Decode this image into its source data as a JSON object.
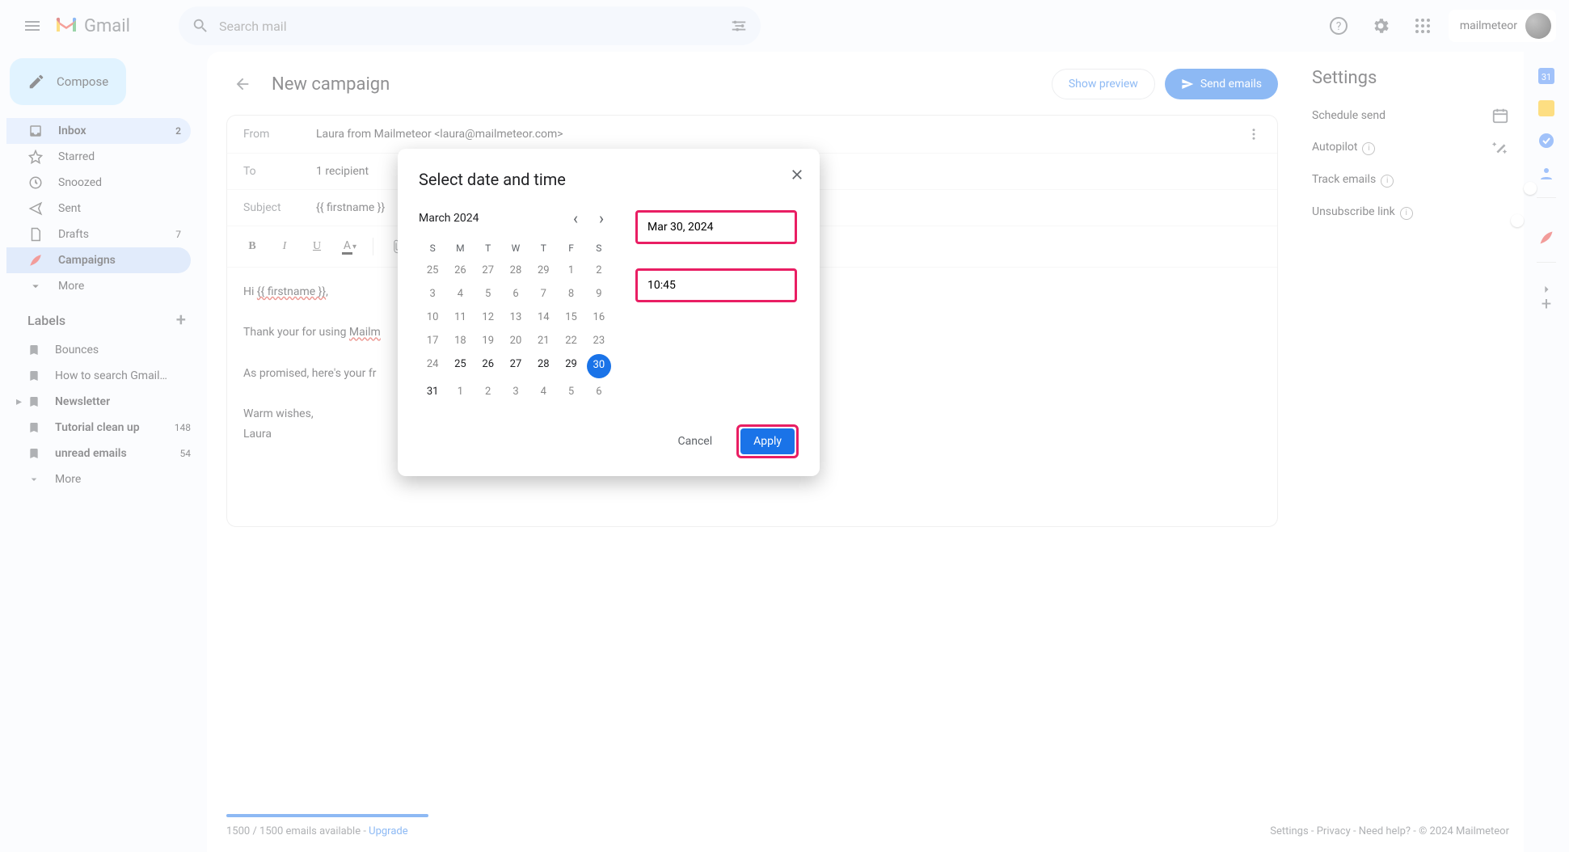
{
  "header": {
    "app_name": "Gmail",
    "search_placeholder": "Search mail",
    "account_name": "mailmeteor"
  },
  "sidebar": {
    "compose": "Compose",
    "items": [
      {
        "label": "Inbox",
        "count": "2"
      },
      {
        "label": "Starred",
        "count": ""
      },
      {
        "label": "Snoozed",
        "count": ""
      },
      {
        "label": "Sent",
        "count": ""
      },
      {
        "label": "Drafts",
        "count": "7"
      },
      {
        "label": "Campaigns",
        "count": ""
      },
      {
        "label": "More",
        "count": ""
      }
    ],
    "labels_header": "Labels",
    "labels": [
      {
        "label": "Bounces",
        "count": "",
        "bold": false
      },
      {
        "label": "How to search Gmail by ...",
        "count": "",
        "bold": false
      },
      {
        "label": "Newsletter",
        "count": "",
        "bold": true,
        "chev": true
      },
      {
        "label": "Tutorial clean up",
        "count": "148",
        "bold": true
      },
      {
        "label": "unread emails",
        "count": "54",
        "bold": true
      },
      {
        "label": "More",
        "count": "",
        "bold": false
      }
    ]
  },
  "campaign": {
    "back_title": "New campaign",
    "show_preview": "Show preview",
    "send_emails": "Send emails",
    "from_label": "From",
    "from_value": "Laura from Mailmeteor <laura@mailmeteor.com>",
    "to_label": "To",
    "to_value": "1 recipient",
    "subject_label": "Subject",
    "subject_value": "{{ firstname }}",
    "body_greeting_pre": "Hi ",
    "body_greeting_token": "{{ firstname }}",
    "body_greeting_post": ",",
    "body_line2_pre": "Thank your for using ",
    "body_line2_token": "Mailm",
    "body_line3": "As promised, here's your fr",
    "body_sign1": "Warm wishes,",
    "body_sign2": "Laura",
    "quota_text": "1500 / 1500 emails available - ",
    "quota_upgrade": "Upgrade"
  },
  "settings": {
    "title": "Settings",
    "items": [
      {
        "label": "Schedule send",
        "ctrl": "calendar"
      },
      {
        "label": "Autopilot",
        "ctrl": "wand",
        "info": true
      },
      {
        "label": "Track emails",
        "ctrl": "toggle_on",
        "info": true
      },
      {
        "label": "Unsubscribe link",
        "ctrl": "toggle_off",
        "info": true
      }
    ]
  },
  "footer": {
    "settings": "Settings",
    "privacy": "Privacy",
    "help": "Need help?",
    "copyright": "© 2024 Mailmeteor"
  },
  "modal": {
    "title": "Select date and time",
    "month": "March 2024",
    "dow": [
      "S",
      "M",
      "T",
      "W",
      "T",
      "F",
      "S"
    ],
    "days": [
      {
        "n": "25",
        "in": false
      },
      {
        "n": "26",
        "in": false
      },
      {
        "n": "27",
        "in": false
      },
      {
        "n": "28",
        "in": false
      },
      {
        "n": "29",
        "in": false
      },
      {
        "n": "1",
        "in": false
      },
      {
        "n": "2",
        "in": false
      },
      {
        "n": "3",
        "in": false
      },
      {
        "n": "4",
        "in": false
      },
      {
        "n": "5",
        "in": false
      },
      {
        "n": "6",
        "in": false
      },
      {
        "n": "7",
        "in": false
      },
      {
        "n": "8",
        "in": false
      },
      {
        "n": "9",
        "in": false
      },
      {
        "n": "10",
        "in": false
      },
      {
        "n": "11",
        "in": false
      },
      {
        "n": "12",
        "in": false
      },
      {
        "n": "13",
        "in": false
      },
      {
        "n": "14",
        "in": false
      },
      {
        "n": "15",
        "in": false
      },
      {
        "n": "16",
        "in": false
      },
      {
        "n": "17",
        "in": false
      },
      {
        "n": "18",
        "in": false
      },
      {
        "n": "19",
        "in": false
      },
      {
        "n": "20",
        "in": false
      },
      {
        "n": "21",
        "in": false
      },
      {
        "n": "22",
        "in": false
      },
      {
        "n": "23",
        "in": false
      },
      {
        "n": "24",
        "in": false
      },
      {
        "n": "25",
        "in": true
      },
      {
        "n": "26",
        "in": true
      },
      {
        "n": "27",
        "in": true
      },
      {
        "n": "28",
        "in": true
      },
      {
        "n": "29",
        "in": true
      },
      {
        "n": "30",
        "in": true,
        "sel": true
      },
      {
        "n": "31",
        "in": true
      },
      {
        "n": "1",
        "in": false
      },
      {
        "n": "2",
        "in": false
      },
      {
        "n": "3",
        "in": false
      },
      {
        "n": "4",
        "in": false
      },
      {
        "n": "5",
        "in": false
      },
      {
        "n": "6",
        "in": false
      }
    ],
    "date_value": "Mar 30, 2024",
    "time_value": "10:45",
    "cancel": "Cancel",
    "apply": "Apply"
  }
}
